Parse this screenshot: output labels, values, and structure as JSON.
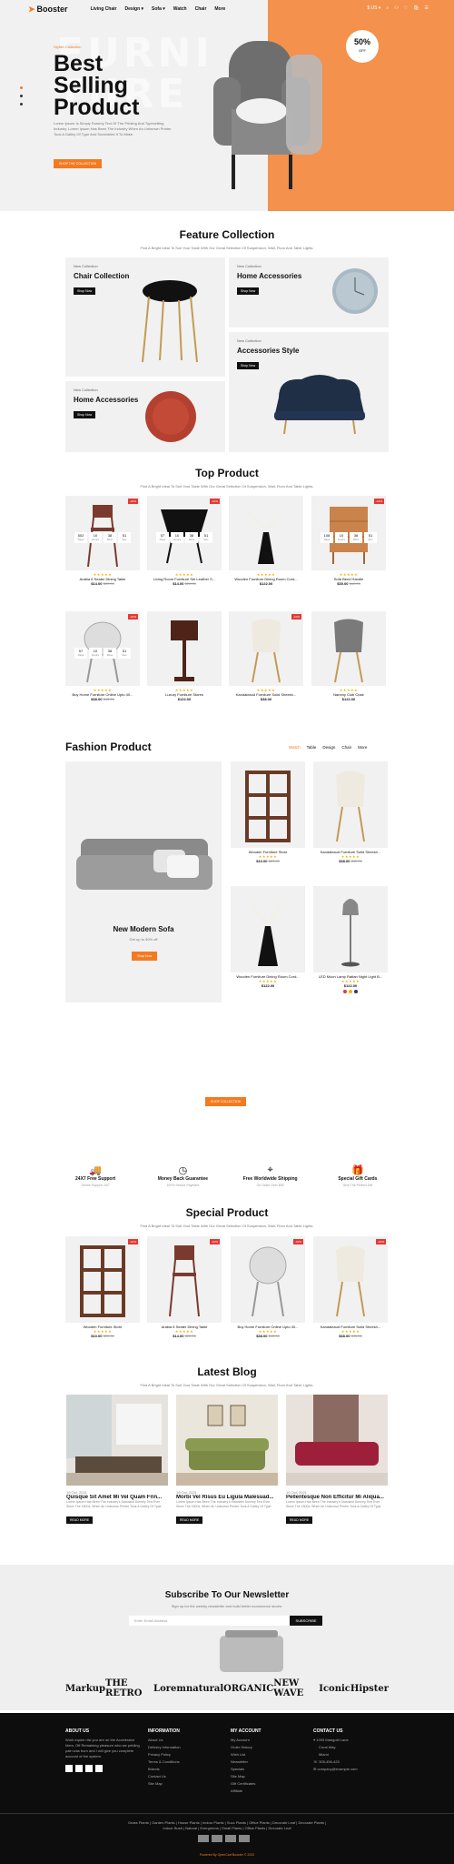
{
  "header": {
    "logo": "Booster",
    "nav": [
      "Living Chair",
      "Design ▾",
      "Sofa ▾",
      "Watch",
      "Chair",
      "More"
    ],
    "lang": "$ US ▾",
    "cart_count": "0"
  },
  "hero": {
    "bg_word": "FURNI TURE",
    "subtitle": "Stylish Collection",
    "title": [
      "Best",
      "Selling",
      "Product"
    ],
    "desc": "Lorem Ipsum Is Simply Dummy Text Of The Printing And Typesetting Industry. Lorem Ipsum Has Been The Industry When An Unknown Printer Took A Galley Of Type And Scrambled It To Make.",
    "button": "SHOP THE COLLECTION",
    "badge": "50%",
    "badge_sub": "OFF"
  },
  "feature": {
    "title": "Feature Collection",
    "desc": "Find A Bright Ideal To Suit Your Taste With Our Great Selection Of Suspension, Wall, Floor And Table Lights.",
    "cards": [
      {
        "label": "New Collection",
        "title": "Chair Collection",
        "btn": "Shop Now"
      },
      {
        "label": "New Collection",
        "title": "Home Accessories",
        "btn": "Shop Now"
      },
      {
        "label": "New Collection",
        "title": "Accessories Style",
        "btn": "Shop Now"
      },
      {
        "label": "New Collection",
        "title": "Home Accessories",
        "btn": "Shop Now"
      }
    ]
  },
  "top": {
    "title": "Top Product",
    "desc": "Find A Bright Ideal To Suit Your Taste With Our Great Selection Of Suspension, Wall, Floor And Table Lights.",
    "products": [
      {
        "name": "Arabia 6 Seater Dining Table",
        "price": "$14.00",
        "old": "$20.00",
        "sale": "-10%"
      },
      {
        "name": "Living Room Furniture Set Leather S...",
        "price": "$14.00",
        "old": "$20.00",
        "sale": "-10%"
      },
      {
        "name": "Wooden Furniture Dining Room Cord...",
        "price": "$122.00",
        "old": "",
        "sale": ""
      },
      {
        "name": "Sofa Bend Handle",
        "price": "$35.00",
        "old": "$40.00",
        "sale": "-10%"
      },
      {
        "name": "Buy Home Furniture Online Upto 40...",
        "price": "$38.00",
        "old": "$45.00",
        "sale": "-10%"
      },
      {
        "name": "Luxury Furniture Stores",
        "price": "$122.00",
        "old": "",
        "sale": ""
      },
      {
        "name": "Kandaleaud Furniture Solid Sheesh...",
        "price": "$38.00",
        "old": "",
        "sale": "-10%"
      },
      {
        "name": "Nammy Club Chair",
        "price": "$122.00",
        "old": "",
        "sale": ""
      }
    ],
    "countdown": [
      "502",
      "10",
      "38",
      "51"
    ],
    "countdown_labels": [
      "Days",
      "Hours",
      "Mins",
      "Sec"
    ],
    "countdown2": [
      "57",
      "10",
      "38",
      "51"
    ],
    "countdown4": [
      "108",
      "10",
      "38",
      "51"
    ],
    "countdown5": [
      "57",
      "10",
      "38",
      "51"
    ]
  },
  "fashion": {
    "title": "Fashion Product",
    "tabs": [
      "Watch",
      "Table",
      "Design",
      "Chair",
      "More"
    ],
    "banner_title": "New Modern Sofa",
    "banner_sub": "Get up to 30% off",
    "banner_btn": "Shop Now",
    "products": [
      {
        "name": "Wooden Furniture Store",
        "price": "$10.00",
        "old": "$20.00"
      },
      {
        "name": "Kandaleaud Furniture Solid Sheesh...",
        "price": "$38.00",
        "old": "$45.00"
      },
      {
        "name": "Wooden Furniture Dining Room Cord...",
        "price": "$122.00",
        "old": ""
      },
      {
        "name": "LED Moon Lamp Rattan Night Light B...",
        "price": "$122.00",
        "old": ""
      }
    ],
    "button": "SHOP COLLECTION"
  },
  "services": [
    {
      "title": "24X7 Free Support",
      "sub": "Online Support 24/7"
    },
    {
      "title": "Money Back Guarantee",
      "sub": "100% Secure Payment"
    },
    {
      "title": "Free Worldwide Shipping",
      "sub": "On Order Over $99"
    },
    {
      "title": "Special Gift Cards",
      "sub": "Give The Perfect Gift"
    }
  ],
  "special": {
    "title": "Special Product",
    "desc": "Find A Bright Ideal To Suit Your Taste With Our Great Selection Of Suspension, Wall, Floor And Table Lights.",
    "products": [
      {
        "name": "Wooden Furniture Store",
        "price": "$10.00",
        "old": "$20.00",
        "sale": "-10%"
      },
      {
        "name": "Arabia 6 Seater Dining Table",
        "price": "$14.00",
        "old": "$20.00",
        "sale": "-10%"
      },
      {
        "name": "Buy Home Furniture Online Upto 40...",
        "price": "$38.00",
        "old": "$45.00",
        "sale": "-10%"
      },
      {
        "name": "Kandaleaud Furniture Solid Sheesh...",
        "price": "$38.00",
        "old": "$45.00",
        "sale": "-10%"
      }
    ]
  },
  "blog": {
    "title": "Latest Blog",
    "desc": "Find A Bright Ideal To Suit Your Taste With Our Great Selection Of Suspension, Wall, Floor And Table Lights.",
    "posts": [
      {
        "date": "19 Oct, 2021",
        "title": "Quisque Sit Amet Mi Vel Quam Frin...",
        "desc": "Lorem Ipsum Has Been The Industry's Standard Dummy Text Ever Since The 1500s, When An Unknown Printer Took A Galley Of Type.",
        "btn": "READ MORE"
      },
      {
        "date": "19 Oct, 2021",
        "title": "Morbi Vel Risus Eu Ligula Malesuad...",
        "desc": "Lorem Ipsum Has Been The Industry's Standard Dummy Text Ever Since The 1500s, When An Unknown Printer Took A Galley Of Type.",
        "btn": "READ MORE"
      },
      {
        "date": "19 Oct, 2021",
        "title": "Pellentesque Non Efficitur Mi Aliqua...",
        "desc": "Lorem Ipsum Has Been The Industry's Standard Dummy Text Ever Since The 1500s, When An Unknown Printer Took A Galley Of Type.",
        "btn": "READ MORE"
      }
    ]
  },
  "newsletter": {
    "title": "Subscribe To Our Newsletter",
    "sub": "Sign up for the weekly newsletter and build better ecommerce stores.",
    "placeholder": "Enter Email Address",
    "btn": "SUBSCRIBE"
  },
  "brands": [
    "Markup",
    "THE RETRO",
    "Lorem",
    "natural",
    "ORGANIC",
    "NEW WAVE",
    "Iconic",
    "Hipster"
  ],
  "footer": {
    "about_h": "ABOUT US",
    "about": "Work equim nisl you are on the Accelerator Idem. Off Remaining pleasure who we pelding pain was born and I will give you complete account of the system.",
    "info_h": "INFORMATION",
    "info": [
      "About Us",
      "Delivery Information",
      "Privacy Policy",
      "Terms & Conditions",
      "Brands",
      "Contact Us",
      "Site Map"
    ],
    "acct_h": "MY ACCOUNT",
    "acct": [
      "My Account",
      "Order History",
      "Wish List",
      "Newsletter",
      "Specials",
      "Site Map",
      "Gift Certificates",
      "Affiliate"
    ],
    "contact_h": "CONTACT US",
    "contact": [
      "1093 Marigold Lane",
      "Coral Way",
      "Miami",
      "305-456-420",
      "company@example.com"
    ],
    "tags": "Grass Plants | Garden Plants | House Plants | Indoor Plants | Succ Plants | Office Plants | Decorate Leaf | Decorate Plants | Indoor Bush | Natural | Evergreens | Small Plants | Office Plants | Decorate Leaf",
    "copyright": "Powered By OpenCart Booster © 2022"
  },
  "colors": {
    "accent": "#f47a20",
    "hero_bg": "#f1f1f1",
    "footer_bg": "#0d0d0d"
  }
}
